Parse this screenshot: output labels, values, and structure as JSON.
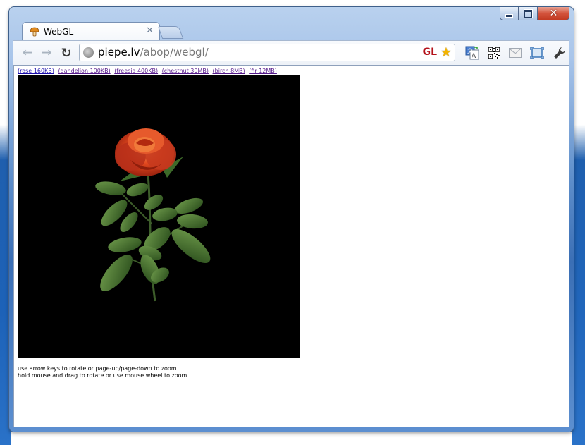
{
  "window": {
    "controls": {
      "minimize": "minimize-icon",
      "maximize": "maximize-icon",
      "close": "close-icon"
    }
  },
  "tabs": [
    {
      "title": "WebGL",
      "favicon": "mushroom-icon",
      "active": true
    }
  ],
  "toolbar": {
    "url_host": "piepe.lv",
    "url_path": "/abop/webgl/",
    "gl_badge": "GL",
    "icons": [
      "back-icon",
      "forward-icon",
      "reload-icon",
      "globe-icon",
      "star-icon",
      "translate-icon",
      "qr-code-icon",
      "mail-icon",
      "fullscreen-icon",
      "wrench-icon"
    ]
  },
  "page": {
    "links": [
      {
        "label": "(rose 160KB)",
        "visited": false
      },
      {
        "label": "(dandelion 100KB)",
        "visited": true
      },
      {
        "label": "(freesia 400KB)",
        "visited": true
      },
      {
        "label": "(chestnut 30MB)",
        "visited": true
      },
      {
        "label": "(birch 8MB)",
        "visited": true
      },
      {
        "label": "(fir 12MB)",
        "visited": true
      }
    ],
    "help_lines": [
      "use arrow keys to rotate or page-up/page-down to zoom",
      "hold mouse and drag to rotate or use mouse wheel to zoom"
    ]
  },
  "colors": {
    "canvas_bg": "#000000",
    "link": "#1a0dab",
    "link_visited": "#551a8b",
    "rose": "#c8321c",
    "leaf": "#3f6b2a"
  }
}
